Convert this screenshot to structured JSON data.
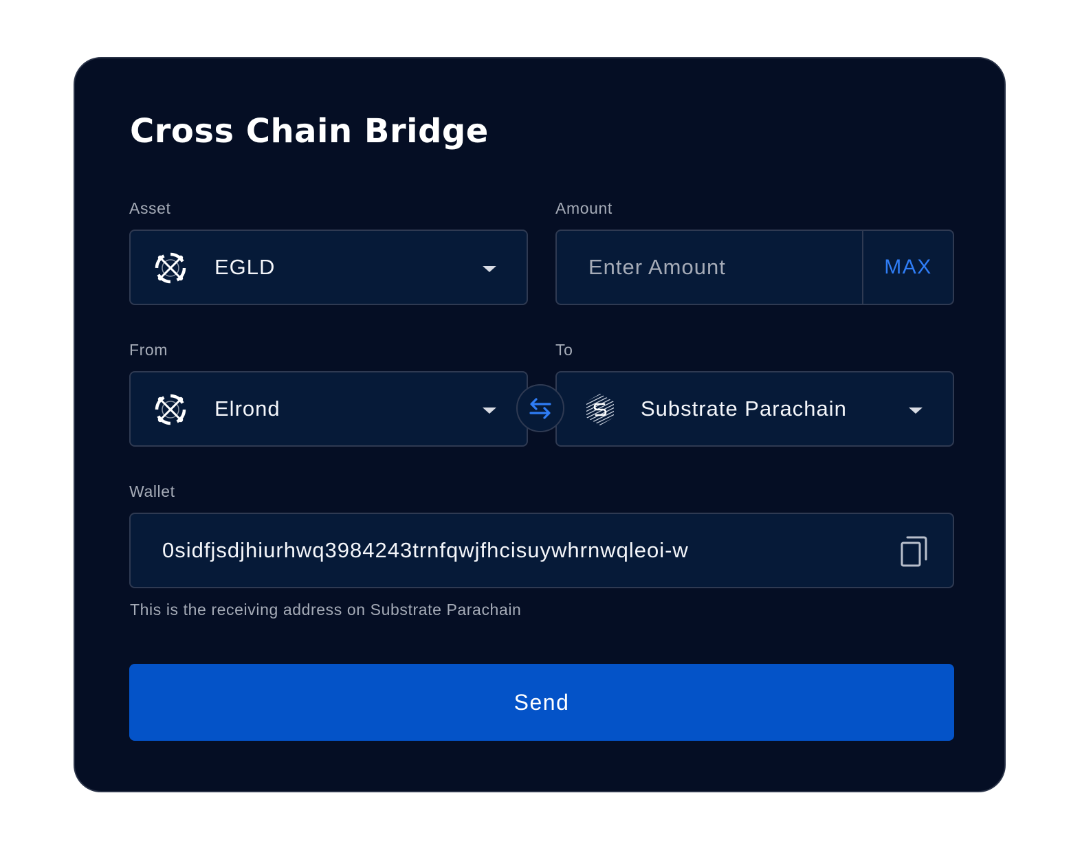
{
  "title": "Cross Chain Bridge",
  "asset": {
    "label": "Asset",
    "selected": "EGLD",
    "icon": "elrond-icon"
  },
  "amount": {
    "label": "Amount",
    "placeholder": "Enter Amount",
    "value": "",
    "max_label": "MAX"
  },
  "from": {
    "label": "From",
    "selected": "Elrond",
    "icon": "elrond-icon"
  },
  "to": {
    "label": "To",
    "selected": "Substrate Parachain",
    "icon": "substrate-icon"
  },
  "wallet": {
    "label": "Wallet",
    "address": "0sidfjsdjhiurhwq3984243trnfqwjfhcisuywhrnwqleoi-w",
    "hint": "This is the receiving address on Substrate Parachain"
  },
  "send_label": "Send",
  "colors": {
    "card_background": "#050e24",
    "field_background": "#061a38",
    "accent": "#2f7df6",
    "button": "#0453c8"
  }
}
